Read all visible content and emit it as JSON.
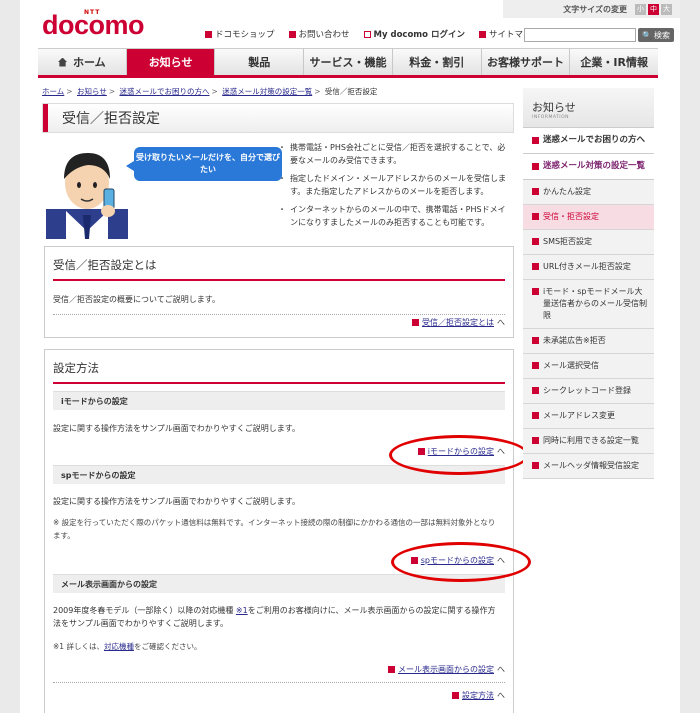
{
  "header": {
    "logo_ntt": "NTT",
    "logo_brand": "docomo",
    "util_links": [
      "ドコモショップ",
      "お問い合わせ",
      "My docomo ログイン",
      "サイトマップ"
    ],
    "font_size_label": "文字サイズの変更",
    "font_sizes": [
      "小",
      "中",
      "大"
    ],
    "search_button": "検索"
  },
  "nav": [
    "ホーム",
    "お知らせ",
    "製品",
    "サービス・機能",
    "料金・割引",
    "お客様サポート",
    "企業・IR情報"
  ],
  "breadcrumb": [
    "ホーム",
    "お知らせ",
    "迷惑メールでお困りの方へ",
    "迷惑メール対策の設定一覧",
    "受信／拒否設定"
  ],
  "page_title": "受信／拒否設定",
  "intro": {
    "bubble": "受け取りたいメールだけを、自分で選びたい",
    "bullets": [
      "携帯電話・PHS会社ごとに受信／拒否を選択することで、必要なメールのみ受信できます。",
      "指定したドメイン・メールアドレスからのメールを受信します。また指定したアドレスからのメールを拒否します。",
      "インターネットからのメールの中で、携帯電話・PHSドメインになりすましたメールのみ拒否することも可能です。"
    ]
  },
  "about": {
    "heading": "受信／拒否設定とは",
    "text": "受信／拒否設定の概要についてご説明します。",
    "link": "受信／拒否設定とは"
  },
  "method": {
    "heading": "設定方法",
    "imode": {
      "sub": "iモードからの設定",
      "text": "設定に関する操作方法をサンプル画面でわかりやすくご説明します。",
      "link": "iモードからの設定"
    },
    "spmode": {
      "sub": "spモードからの設定",
      "text": "設定に関する操作方法をサンプル画面でわかりやすくご説明します。",
      "note": "※ 設定を行っていただく際のパケット通信料は無料です。インターネット接続の際の制御にかかわる通信の一部は無料対象外となります。",
      "link": "spモードからの設定"
    },
    "mail": {
      "sub": "メール表示画面からの設定",
      "text_a": "2009年度冬春モデル（一部除く）以降の対応機種 ",
      "text_ref": "※1",
      "text_b": "をご利用のお客様向けに、メール表示画面からの設定に関する操作方法をサンプル画面でわかりやすくご説明します。",
      "note_a": "※1 詳しくは、",
      "note_link": "対応機種",
      "note_b": "をご確認ください。",
      "link": "メール表示画面からの設定"
    },
    "bottom_link": "設定方法"
  },
  "sidebar": {
    "title": "お知らせ",
    "subtitle": "INFORMATION",
    "section1": "迷惑メールでお困りの方へ",
    "section2": "迷惑メール対策の設定一覧",
    "items": [
      "かんたん設定",
      "受信・拒否設定",
      "SMS拒否設定",
      "URL付きメール拒否設定",
      "iモード・spモードメール大量送信者からのメール受信制限",
      "未承諾広告※拒否",
      "メール選択受信",
      "シークレットコード登録",
      "メールアドレス変更",
      "同時に利用できる設定一覧",
      "メールヘッダ情報受信設定"
    ]
  },
  "colors": {
    "brand": "#cc0033",
    "link": "#2a2a8c",
    "annotation": "#e00000",
    "bubble": "#2a78d8"
  }
}
